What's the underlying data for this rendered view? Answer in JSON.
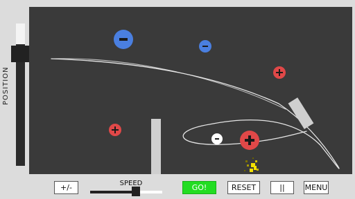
{
  "position_slider": {
    "label": "POSITION",
    "level_fraction": 0.86
  },
  "toolbar": {
    "sign_toggle_label": "+/-",
    "speed_label": "SPEED",
    "speed_fraction": 0.67,
    "go_label": "GO!",
    "reset_label": "RESET",
    "pause_label": "||",
    "menu_label": "MENU"
  },
  "colors": {
    "arena": "#3a3a3a",
    "negative_charge": "#4a7fe0",
    "positive_charge": "#e04848",
    "go_button": "#22dd22",
    "trail": "#e6e6e6",
    "particles": "#f2e000"
  },
  "icons": {
    "negative": "minus-icon",
    "positive": "plus-icon"
  }
}
